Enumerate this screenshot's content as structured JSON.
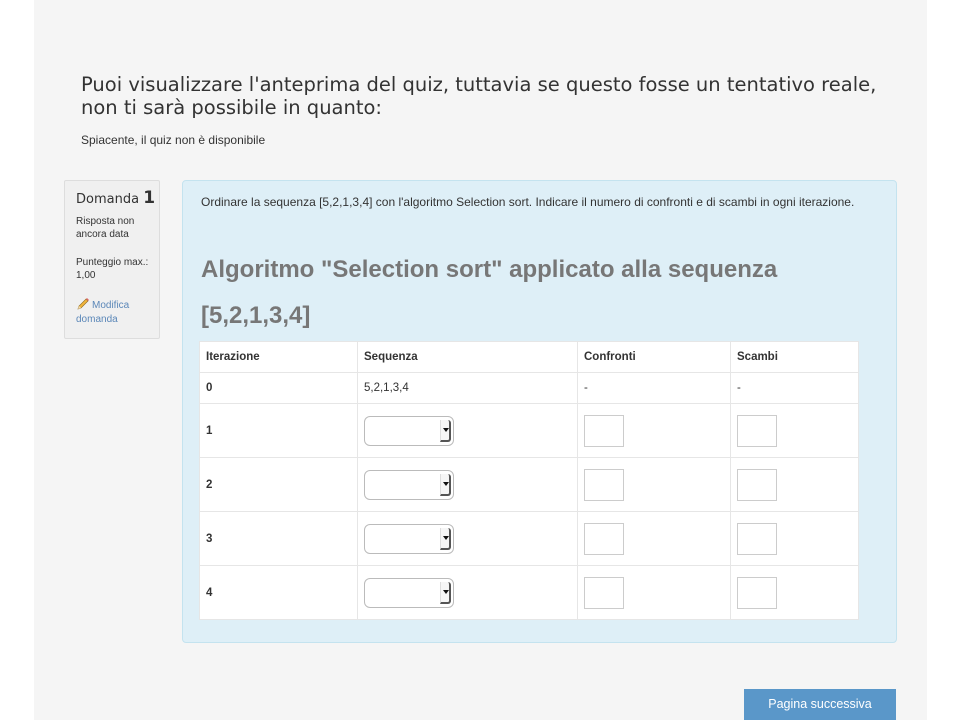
{
  "preview": {
    "heading": "Puoi visualizzare l'anteprima del quiz, tuttavia se questo fosse un tentativo reale, non ti sarà possibile in quanto:",
    "notice": "Spiacente, il quiz non è disponibile"
  },
  "question_info": {
    "label": "Domanda",
    "number": "1",
    "state": "Risposta non ancora data",
    "grade": "Punteggio max.: 1,00",
    "edit_label": "Modifica domanda",
    "edit_icon": "pencil-icon"
  },
  "question": {
    "text": "Ordinare la sequenza [5,2,1,3,4] con l'algoritmo Selection sort. Indicare il numero di confronti e di scambi in ogni iterazione.",
    "title": "Algoritmo \"Selection sort\" applicato alla sequenza [5,2,1,3,4]"
  },
  "table": {
    "headers": [
      "Iterazione",
      "Sequenza",
      "Confronti",
      "Scambi"
    ],
    "row0": {
      "iteration": "0",
      "sequence": "5,2,1,3,4",
      "comparisons": "-",
      "swaps": "-"
    },
    "rows": [
      {
        "iteration": "1"
      },
      {
        "iteration": "2"
      },
      {
        "iteration": "3"
      },
      {
        "iteration": "4"
      }
    ]
  },
  "navigation": {
    "next_label": "Pagina successiva"
  },
  "colors": {
    "content_bg": "#deeff7",
    "button_bg": "#5a97c9",
    "link": "#5b87b8"
  }
}
